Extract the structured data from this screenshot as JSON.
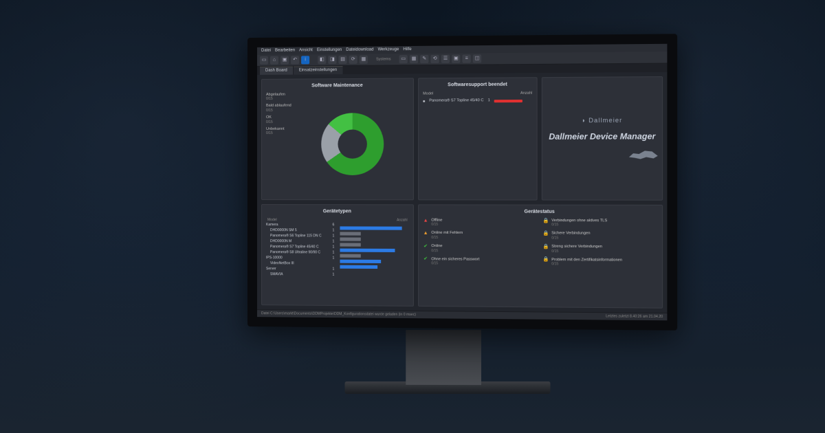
{
  "menubar": [
    "Datei",
    "Bearbeiten",
    "Ansicht",
    "Einstellungen",
    "Dateidownload",
    "Werkzeuge",
    "Hilfe"
  ],
  "tabs": [
    {
      "label": "Dash Board",
      "active": true
    },
    {
      "label": "Einsatzeinstellungen",
      "active": false
    }
  ],
  "toolbar_section_label": "Systems",
  "panels": {
    "maintenance": {
      "title": "Software Maintenance",
      "legend": [
        {
          "label": "Abgelaufen",
          "count": "0/15"
        },
        {
          "label": "Bald ablaufend",
          "count": "0/15"
        },
        {
          "label": "OK",
          "count": "0/15"
        },
        {
          "label": "Unbekannt",
          "count": "0/15"
        }
      ]
    },
    "support": {
      "title": "Softwaresupport beendet",
      "col_model": "Model",
      "col_count": "Anzahl",
      "row_model": "Panomera® S7 Topline 45/40 C",
      "row_count": "1"
    },
    "brand": {
      "company": "Dallmeier",
      "product": "Dallmeier Device Manager"
    },
    "devicetypes": {
      "title": "Gerätetypen",
      "col_model": "Model",
      "col_count": "Anzahl",
      "tree": [
        {
          "label": "Kamera",
          "count": "6",
          "depth": 0
        },
        {
          "label": "DHD0000N SM 5",
          "count": "1",
          "depth": 1
        },
        {
          "label": "Panomera® S6 Topline 115 DN C",
          "count": "1",
          "depth": 1
        },
        {
          "label": "DHD0000N M",
          "count": "1",
          "depth": 1
        },
        {
          "label": "Panomera® S7 Topline 45/40 C",
          "count": "1",
          "depth": 1
        },
        {
          "label": "Panomera® S8 Ultraline 90/90 C",
          "count": "1",
          "depth": 1
        },
        {
          "label": "IPS-10000",
          "count": "1",
          "depth": 0
        },
        {
          "label": "VideoNetBox III",
          "count": "",
          "depth": 1
        },
        {
          "label": "Server",
          "count": "1",
          "depth": 0
        },
        {
          "label": "SMAVIA",
          "count": "1",
          "depth": 1
        }
      ]
    },
    "devicestatus": {
      "title": "Gerätestatus",
      "left": [
        {
          "icon": "tri-red",
          "label": "Offline",
          "count": "0/15"
        },
        {
          "icon": "tri-orange",
          "label": "Online mit Fehlern",
          "count": "0/15"
        },
        {
          "icon": "chk-green",
          "label": "Online",
          "count": "0/15"
        },
        {
          "icon": "chk-green",
          "label": "Ohne ein sicheres Passwort",
          "count": "0/15"
        }
      ],
      "right": [
        {
          "icon": "lock",
          "label": "Verbindungen ohne aktives TLS",
          "count": "0/15"
        },
        {
          "icon": "lock",
          "label": "Sichere Verbindungen",
          "count": "0/15"
        },
        {
          "icon": "lock green",
          "label": "Streng sichere Verbindungen",
          "count": "0/15"
        },
        {
          "icon": "lock",
          "label": "Problem mit den Zertifikatsinformationen",
          "count": "0/15"
        }
      ]
    }
  },
  "statusbar": {
    "left": "Datei C:\\Users\\markt\\Documents\\DDMProjekte\\DDM_Konfigurationsdatei wurde geladen (in 0 msec)",
    "right": "Letztes zuletzt 8.40:26 am 21.04.20"
  },
  "chart_data": [
    {
      "type": "pie",
      "title": "Software Maintenance",
      "categories": [
        "Abgelaufen",
        "Bald ablaufend",
        "OK",
        "Unbekannt"
      ],
      "values": [
        0,
        0,
        10,
        5
      ],
      "colors": [
        "#e84545",
        "#f0a030",
        "#2e9e2e",
        "#9aa0a8"
      ]
    },
    {
      "type": "bar",
      "title": "Gerätetypen",
      "categories": [
        "Kamera",
        "DHD0000N SM 5",
        "Panomera S6",
        "DHD0000N M",
        "Panomera S7",
        "Panomera S8",
        "IPS-10000",
        "Server"
      ],
      "values": [
        6,
        1,
        1,
        1,
        1,
        1,
        1,
        1
      ],
      "colors": [
        "#2c7be5",
        "#6a6e78",
        "#6a6e78",
        "#6a6e78",
        "#2c7be5",
        "#6a6e78",
        "#2c7be5",
        "#2c7be5"
      ]
    }
  ]
}
